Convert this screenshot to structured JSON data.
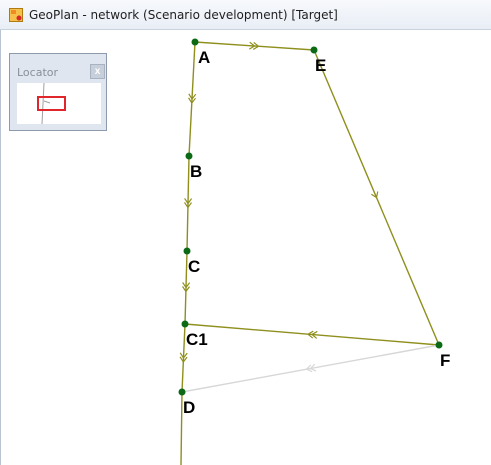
{
  "window": {
    "title": "GeoPlan - network (Scenario development)  [Target]",
    "icon": "geoplan-app-icon"
  },
  "locator": {
    "title": "Locator",
    "close_glyph": "x"
  },
  "colors": {
    "link": "#8f8f1e",
    "link_ghost": "#d7d7d7",
    "node": "#0c6a16",
    "locator_view": "#e0262a"
  },
  "network": {
    "nodes": [
      {
        "id": "A",
        "label": "A"
      },
      {
        "id": "B",
        "label": "B"
      },
      {
        "id": "C",
        "label": "C"
      },
      {
        "id": "C1",
        "label": "C1"
      },
      {
        "id": "D",
        "label": "D"
      },
      {
        "id": "E",
        "label": "E"
      },
      {
        "id": "F",
        "label": "F"
      }
    ],
    "links": [
      {
        "from": "A",
        "to": "B",
        "arrow": "double"
      },
      {
        "from": "B",
        "to": "C",
        "arrow": "double"
      },
      {
        "from": "C",
        "to": "C1",
        "arrow": "double"
      },
      {
        "from": "C1",
        "to": "D",
        "arrow": "double"
      },
      {
        "from": "A",
        "to": "E",
        "arrow": "double"
      },
      {
        "from": "E",
        "to": "F",
        "arrow": "single"
      },
      {
        "from": "F",
        "to": "C1",
        "arrow": "double"
      },
      {
        "from": "F",
        "to": "D",
        "arrow": "double",
        "ghost": true
      }
    ]
  }
}
